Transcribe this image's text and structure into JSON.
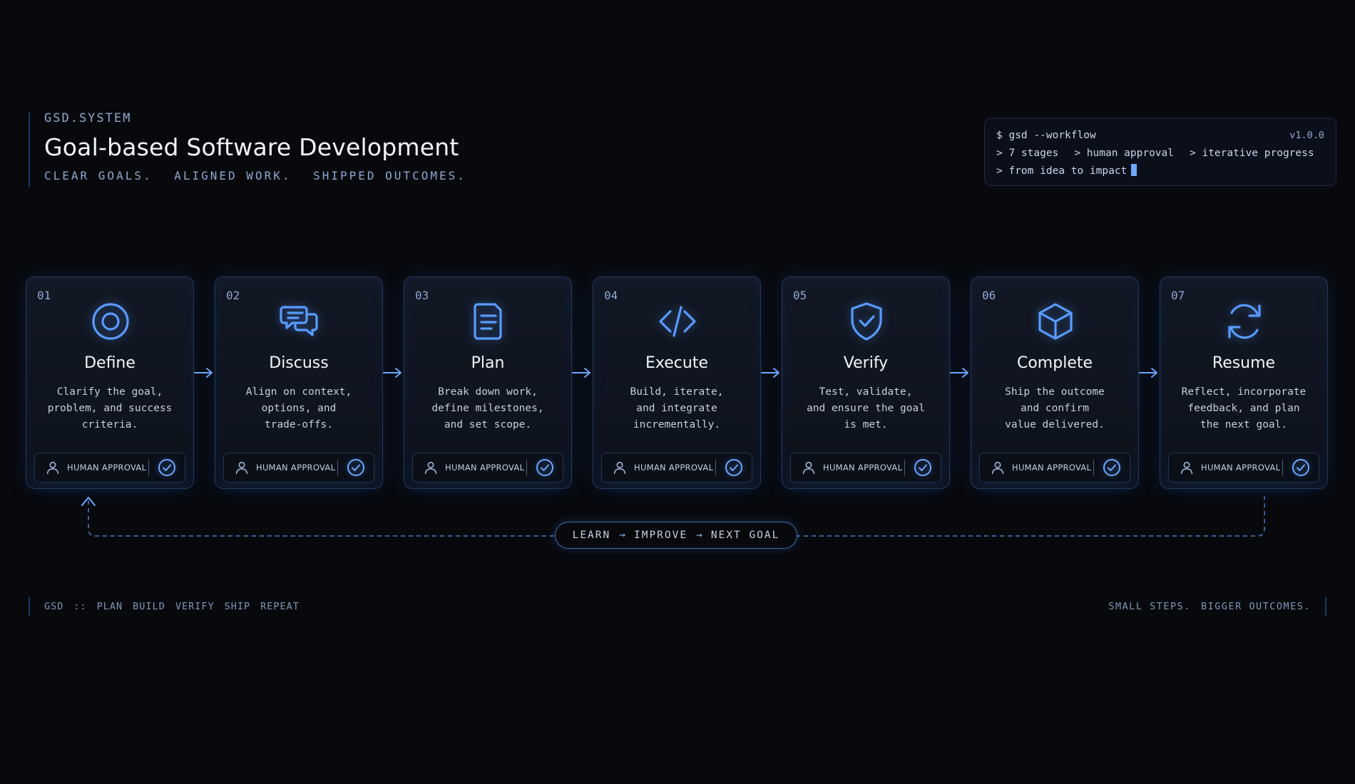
{
  "header": {
    "brand": "GSD.SYSTEM",
    "title": "Goal-based Software Development",
    "tagline": [
      "CLEAR GOALS.",
      "ALIGNED WORK.",
      "SHIPPED OUTCOMES."
    ]
  },
  "terminal": {
    "command": "$ gsd --workflow",
    "version": "v1.0.0",
    "line2": [
      "> 7 stages",
      "> human approval",
      "> iterative progress"
    ],
    "line3": "> from idea to impact"
  },
  "stages": [
    {
      "num": "01",
      "icon": "target-icon",
      "title": "Define",
      "desc": [
        "Clarify the goal,",
        "problem, and success",
        "criteria."
      ],
      "approval": "HUMAN APPROVAL"
    },
    {
      "num": "02",
      "icon": "chat-bubbles-icon",
      "title": "Discuss",
      "desc": [
        "Align on context,",
        "options, and",
        "trade-offs."
      ],
      "approval": "HUMAN APPROVAL"
    },
    {
      "num": "03",
      "icon": "document-icon",
      "title": "Plan",
      "desc": [
        "Break down work,",
        "define milestones,",
        "and set scope."
      ],
      "approval": "HUMAN APPROVAL"
    },
    {
      "num": "04",
      "icon": "code-icon",
      "title": "Execute",
      "desc": [
        "Build, iterate,",
        "and integrate",
        "incrementally."
      ],
      "approval": "HUMAN APPROVAL"
    },
    {
      "num": "05",
      "icon": "shield-check-icon",
      "title": "Verify",
      "desc": [
        "Test, validate,",
        "and ensure the goal",
        "is met."
      ],
      "approval": "HUMAN APPROVAL"
    },
    {
      "num": "06",
      "icon": "cube-icon",
      "title": "Complete",
      "desc": [
        "Ship the outcome",
        "and confirm",
        "value delivered."
      ],
      "approval": "HUMAN APPROVAL"
    },
    {
      "num": "07",
      "icon": "refresh-icon",
      "title": "Resume",
      "desc": [
        "Reflect, incorporate",
        "feedback, and plan",
        "the next goal."
      ],
      "approval": "HUMAN APPROVAL"
    }
  ],
  "loop": {
    "steps": [
      "LEARN",
      "IMPROVE",
      "NEXT GOAL"
    ],
    "arrow": "→"
  },
  "footer": {
    "left": [
      "GSD",
      "::",
      "PLAN",
      "BUILD",
      "VERIFY",
      "SHIP",
      "REPEAT"
    ],
    "right": [
      "SMALL STEPS.",
      "BIGGER OUTCOMES."
    ]
  },
  "colors": {
    "accent": "#5a9bff",
    "background": "#07090d",
    "card_border": "#25395a"
  }
}
